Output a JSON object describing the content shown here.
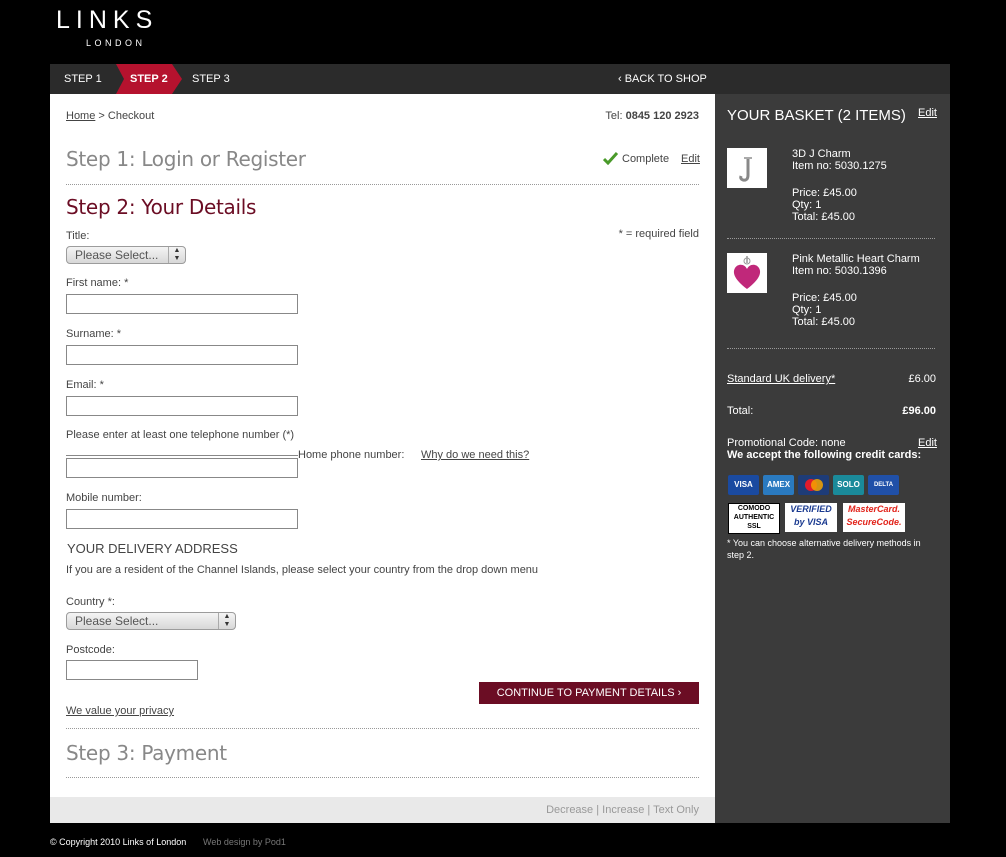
{
  "logo": {
    "main": "LINKS",
    "sub": "LONDON"
  },
  "stepbar": {
    "step1": "STEP 1",
    "step2": "STEP 2",
    "step3": "STEP 3",
    "back": "‹ BACK TO SHOP"
  },
  "breadcrumb": {
    "home": "Home",
    "sep": " > Checkout"
  },
  "tel": {
    "label": "Tel: ",
    "number": "0845 120 2923"
  },
  "step1": {
    "title": "Step 1: Login or Register",
    "status": "Complete",
    "edit": "Edit"
  },
  "step2": {
    "title": "Step 2: Your Details",
    "required_note": "* = required field"
  },
  "form": {
    "title_label": "Title:",
    "title_select": "Please Select...",
    "first_name_label": "First name: *",
    "surname_label": "Surname: *",
    "email_label": "Email: *",
    "phone_note": "Please enter at least one telephone number (*)",
    "home_phone_label": "Home phone number:",
    "why_link": "Why do we need this?",
    "mobile_label": "Mobile number:",
    "delivery_heading": "YOUR DELIVERY ADDRESS",
    "delivery_note": "If you are a resident of the Channel Islands, please select your country from the drop down menu",
    "country_label": "Country *:",
    "country_select": "Please Select...",
    "postcode_label": "Postcode:",
    "continue_button": "CONTINUE TO PAYMENT DETAILS ›",
    "privacy_link": "We value your privacy"
  },
  "step3": {
    "title": "Step 3: Payment"
  },
  "textsize": {
    "decrease": "Decrease",
    "increase": "Increase",
    "text_only": "Text Only",
    "sep": " | "
  },
  "footer": {
    "copyright": "© Copyright 2010 Links of London",
    "design": "Web design by Pod1"
  },
  "basket": {
    "title": "YOUR BASKET (2 ITEMS)",
    "edit": "Edit",
    "items": [
      {
        "name": "3D J Charm",
        "item_no": "Item no: 5030.1275",
        "price": "Price: £45.00",
        "qty": "Qty: 1",
        "total": "Total: £45.00"
      },
      {
        "name": "Pink Metallic Heart Charm",
        "item_no": "Item no: 5030.1396",
        "price": "Price: £45.00",
        "qty": "Qty: 1",
        "total": "Total: £45.00"
      }
    ],
    "delivery_label": "Standard UK delivery*",
    "delivery_value": "£6.00",
    "total_label": "Total:",
    "total_value": "£96.00",
    "promo": "Promotional Code: none",
    "promo_edit": "Edit",
    "cards_heading": "We accept the following credit cards:",
    "cards": [
      "VISA",
      "AMEX",
      "MC",
      "SOLO",
      "DELTA"
    ],
    "badges": {
      "comodo": "COMODO AUTHENTIC SSL",
      "verified": "VERIFIED by VISA",
      "securecode": "MasterCard. SecureCode."
    },
    "footnote": "* You can choose alternative delivery methods in step 2."
  },
  "colors": {
    "brand": "#6b0d24",
    "sidebar": "#3b3b3b",
    "stepbar": "#2b2b2b",
    "active_step": "#b5122e"
  }
}
